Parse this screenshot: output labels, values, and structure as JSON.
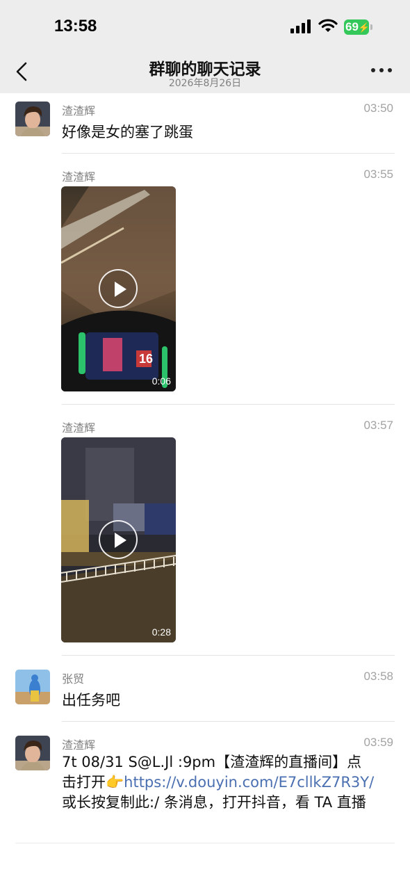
{
  "status_bar": {
    "time": "13:58",
    "battery": "69"
  },
  "nav": {
    "title": "群聊的聊天记录",
    "subtitle": "2026年8月26日"
  },
  "messages": [
    {
      "sender": "渣渣辉",
      "time": "03:50",
      "text": "好像是女的塞了跳蛋"
    },
    {
      "sender": "渣渣辉",
      "time": "03:55",
      "video_duration": "0:06",
      "overlay_number": "16"
    },
    {
      "sender": "渣渣辉",
      "time": "03:57",
      "video_duration": "0:28"
    },
    {
      "sender": "张贸",
      "time": "03:58",
      "text": "出任务吧"
    },
    {
      "sender": "渣渣辉",
      "time": "03:59",
      "text_line1": "7t 08/31 S@L.Jl :9pm【渣渣辉的直播间】点",
      "text_line2_prefix": "击打开",
      "emoji": "👉",
      "link": "https://v.douyin.com/E7cllkZ7R3Y/",
      "text_line3": "或长按复制此:/ 条消息，打开抖音，看 TA 直播"
    }
  ],
  "icons": {
    "back": "chevron-left-icon",
    "more": "more-dots-icon",
    "signal": "cellular-signal-icon",
    "wifi": "wifi-icon",
    "battery": "battery-icon",
    "play": "play-icon"
  },
  "colors": {
    "link": "#4a6fb0",
    "battery": "#34c759",
    "header_bg": "#ededed"
  }
}
